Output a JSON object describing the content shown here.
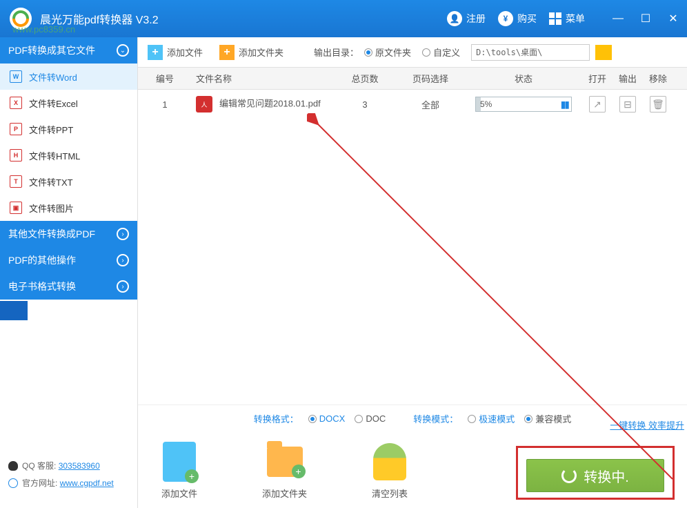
{
  "titlebar": {
    "title": "晨光万能pdf转换器 V3.2",
    "register": "注册",
    "buy": "购买",
    "menu": "菜单"
  },
  "watermark": "www.pc8359.cn",
  "sidebar": {
    "groups": [
      {
        "label": "PDF转换成其它文件",
        "open": true
      },
      {
        "label": "其他文件转换成PDF",
        "open": false
      },
      {
        "label": "PDF的其他操作",
        "open": false
      },
      {
        "label": "电子书格式转换",
        "open": false
      }
    ],
    "items": [
      {
        "icon": "W",
        "label": "文件转Word",
        "active": true
      },
      {
        "icon": "X",
        "label": "文件转Excel"
      },
      {
        "icon": "P",
        "label": "文件转PPT"
      },
      {
        "icon": "H",
        "label": "文件转HTML"
      },
      {
        "icon": "T",
        "label": "文件转TXT"
      },
      {
        "icon": "▣",
        "label": "文件转图片"
      }
    ],
    "footer": {
      "qq_label": "QQ 客服:",
      "qq": "303583960",
      "site_label": "官方网址:",
      "site": "www.cgpdf.net"
    }
  },
  "toolbar": {
    "add_file": "添加文件",
    "add_folder": "添加文件夹",
    "output_label": "输出目录：",
    "orig_folder": "原文件夹",
    "custom": "自定义",
    "path": "D:\\tools\\桌面\\"
  },
  "table": {
    "headers": {
      "num": "编号",
      "name": "文件名称",
      "pages": "总页数",
      "range": "页码选择",
      "status": "状态",
      "open": "打开",
      "out": "输出",
      "del": "移除"
    },
    "rows": [
      {
        "num": "1",
        "name": "编辑常见问题2018.01.pdf",
        "pages": "3",
        "range": "全部",
        "progress_pct": 5,
        "progress_text": "5%"
      }
    ]
  },
  "format_bar": {
    "format_label": "转换格式：",
    "docx": "DOCX",
    "doc": "DOC",
    "mode_label": "转换模式：",
    "fast": "极速模式",
    "compat": "兼容模式"
  },
  "bottom": {
    "add_file": "添加文件",
    "add_folder": "添加文件夹",
    "clear": "清空列表",
    "tip": "一键转换  效率提升",
    "convert": "转换中."
  }
}
